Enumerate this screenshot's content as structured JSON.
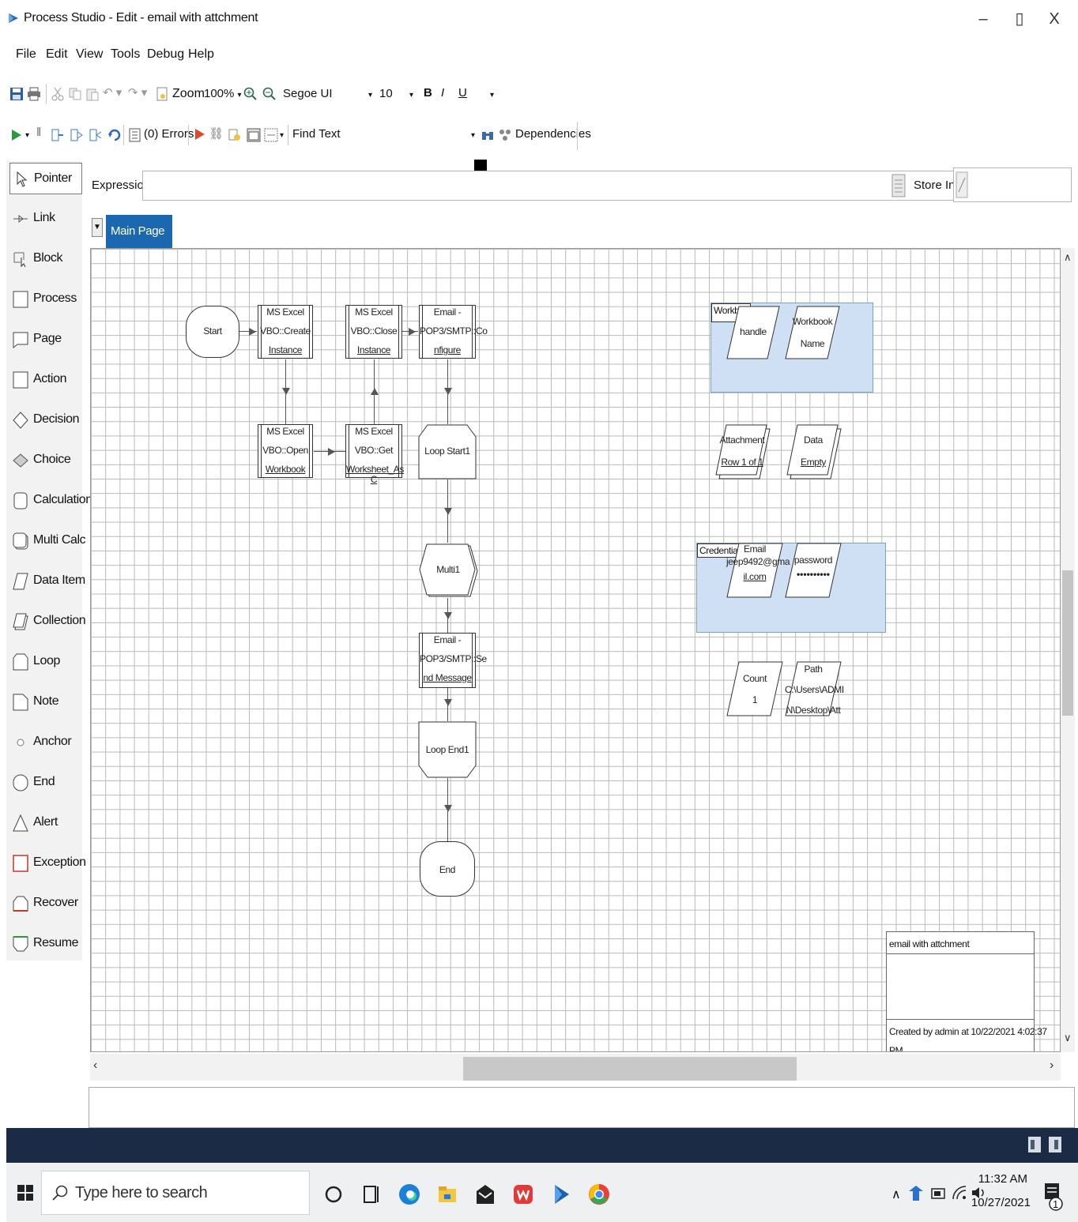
{
  "window": {
    "title": "Process Studio  - Edit - email with attchment",
    "controls": {
      "minimize": "–",
      "restore": "▯",
      "close": "X"
    }
  },
  "menu": [
    "File",
    "Edit",
    "View",
    "Tools",
    "Debug",
    "Help"
  ],
  "toolbar1": {
    "zoom_label": "Zoom",
    "zoom_value": "100%",
    "font_name": "Segoe UI",
    "font_size": "10",
    "bold": "B",
    "italic": "I",
    "underline": "U"
  },
  "toolbar2": {
    "errors": "(0) Errors",
    "find_label": "Find Text",
    "dependencies": "Dependencies"
  },
  "palette": [
    {
      "label": "Pointer",
      "icon": "pointer-icon"
    },
    {
      "label": "Link",
      "icon": "link-icon"
    },
    {
      "label": "Block",
      "icon": "block-icon"
    },
    {
      "label": "Process",
      "icon": "process-icon"
    },
    {
      "label": "Page",
      "icon": "page-icon"
    },
    {
      "label": "Action",
      "icon": "action-icon"
    },
    {
      "label": "Decision",
      "icon": "decision-icon"
    },
    {
      "label": "Choice",
      "icon": "choice-icon"
    },
    {
      "label": "Calculation",
      "icon": "calculation-icon"
    },
    {
      "label": "Multi Calc",
      "icon": "multi-calc-icon"
    },
    {
      "label": "Data Item",
      "icon": "data-item-icon"
    },
    {
      "label": "Collection",
      "icon": "collection-icon"
    },
    {
      "label": "Loop",
      "icon": "loop-icon"
    },
    {
      "label": "Note",
      "icon": "note-icon"
    },
    {
      "label": "Anchor",
      "icon": "anchor-icon"
    },
    {
      "label": "End",
      "icon": "end-icon"
    },
    {
      "label": "Alert",
      "icon": "alert-icon"
    },
    {
      "label": "Exception",
      "icon": "exception-icon"
    },
    {
      "label": "Recover",
      "icon": "recover-icon"
    },
    {
      "label": "Resume",
      "icon": "resume-icon"
    }
  ],
  "expression": {
    "label": "Expression:",
    "value": "",
    "store_label": "Store In:",
    "store_value": ""
  },
  "tabs": [
    {
      "label": "Main Page",
      "active": true
    }
  ],
  "diagram": {
    "start": "Start",
    "create_instance": [
      "MS Excel",
      "VBO::Create",
      "Instance"
    ],
    "close_instance": [
      "MS Excel",
      "VBO::Close",
      "Instance"
    ],
    "configure": [
      "Email -",
      "POP3/SMTP::Co",
      "nfigure"
    ],
    "open_workbook": [
      "MS Excel",
      "VBO::Open",
      "Workbook"
    ],
    "get_worksheet": [
      "MS Excel",
      "VBO::Get",
      "Worksheet_As C"
    ],
    "loop_start": "Loop Start1",
    "multi": "Multi1",
    "send_message": [
      "Email -",
      "POP3/SMTP::Se",
      "nd Message"
    ],
    "loop_end": "Loop End1",
    "end": "End",
    "block_workbook": {
      "label": "Workbo",
      "items": [
        [
          "handle"
        ],
        [
          "Workbook",
          "Name"
        ]
      ]
    },
    "attachment": [
      "Attachment",
      "Row 1 of 1"
    ],
    "data": [
      "Data",
      "Empty"
    ],
    "block_credentials": {
      "label": "Credentials",
      "items": [
        [
          "Email",
          "jeep9492@gma",
          "il.com"
        ],
        [
          "password",
          "••••••••••"
        ]
      ]
    },
    "count": [
      "Count",
      "1"
    ],
    "path": [
      "Path",
      "C:\\Users\\ADMI",
      "N\\Desktop\\Att"
    ],
    "info_note": {
      "name": "email with attchment",
      "created": "Created by admin at 10/22/2021 4:02:37",
      "created_cont": "PM"
    }
  },
  "taskbar": {
    "search_placeholder": "Type here to search",
    "time": "11:32 AM",
    "date": "10/27/2021",
    "notification_count": "1"
  },
  "colors": {
    "accent": "#1b68b0",
    "block_fill": "#cfe0f5",
    "dark_band": "#1b2b45"
  }
}
